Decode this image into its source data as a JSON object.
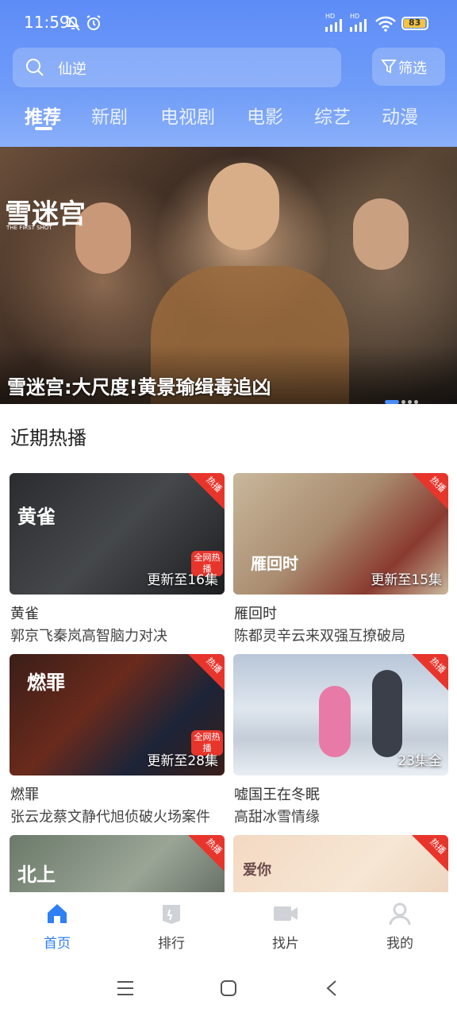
{
  "status_bar": {
    "time": "11:59",
    "battery": "83",
    "signal1": "HD",
    "signal2": "HD"
  },
  "search": {
    "query": "仙逆"
  },
  "filter": {
    "label": "筛选"
  },
  "tabs": [
    "推荐",
    "新剧",
    "电视剧",
    "电影",
    "综艺",
    "动漫"
  ],
  "banner": {
    "caption": "雪迷宫:大尺度!黄景瑜缉毒追凶",
    "logo_text": "雪迷宫",
    "logo_sub": "THE FIRST SHOT"
  },
  "section": {
    "title": "近期热播"
  },
  "cards": [
    {
      "name": "黄雀",
      "desc": "郭京飞秦岚高智脑力对决",
      "episodes": "更新至16集",
      "hot": "热播",
      "poster_text": "黄雀",
      "badge": "全网热播"
    },
    {
      "name": "雁回时",
      "desc": "陈都灵辛云来双强互撩破局",
      "episodes": "更新至15集",
      "hot": "热播",
      "poster_text": "雁回时"
    },
    {
      "name": "燃罪",
      "desc": "张云龙蔡文静代旭侦破火场案件",
      "episodes": "更新至28集",
      "hot": "热播",
      "poster_text": "燃罪",
      "badge": "全网热播"
    },
    {
      "name": "嘘国王在冬眠",
      "desc": "高甜冰雪情缘",
      "episodes": "23集全",
      "hot": "热播"
    },
    {
      "hot": "热播",
      "poster_text": "北上"
    },
    {
      "hot": "热播",
      "poster_text": "爱你"
    }
  ],
  "bottom_nav": [
    {
      "label": "首页",
      "icon": "home-icon"
    },
    {
      "label": "排行",
      "icon": "ranking-icon"
    },
    {
      "label": "找片",
      "icon": "video-icon"
    },
    {
      "label": "我的",
      "icon": "profile-icon"
    }
  ],
  "colors": {
    "accent": "#2f7ff5",
    "header": "#5d8cf7",
    "hot": "#e8352c"
  }
}
